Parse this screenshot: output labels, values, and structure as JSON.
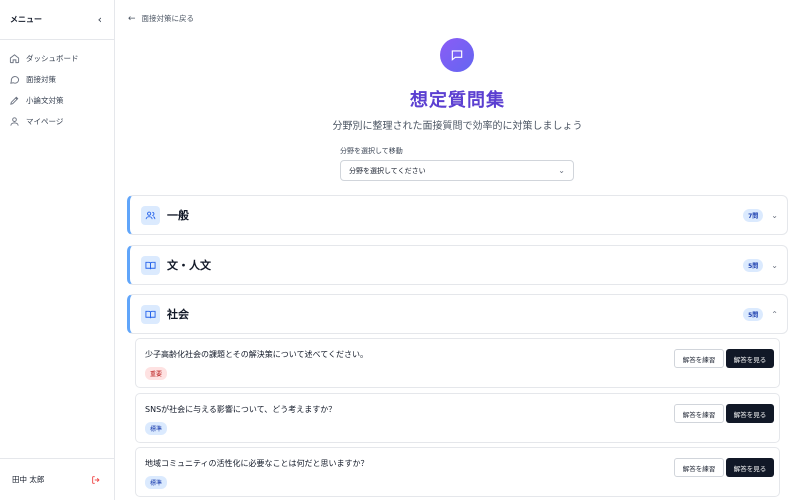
{
  "sidebar": {
    "title": "メニュー",
    "collapse_icon": "‹",
    "items": [
      {
        "label": "ダッシュボード",
        "icon": "home-icon"
      },
      {
        "label": "面接対策",
        "icon": "chat-bubble-icon"
      },
      {
        "label": "小論文対策",
        "icon": "pen-icon"
      },
      {
        "label": "マイページ",
        "icon": "user-icon"
      }
    ],
    "user_name": "田中 太郎",
    "logout_icon": "logout-icon"
  },
  "main": {
    "back_link": "面接対策に戻る",
    "title": "想定質問集",
    "subtitle": "分野別に整理された面接質問で効率的に対策しましょう",
    "select_label": "分野を選択して移動",
    "select_value": "分野を選択してください",
    "sections": [
      {
        "title": "一般",
        "count": "7問",
        "icon": "users-icon",
        "expanded": false
      },
      {
        "title": "文・人文",
        "count": "5問",
        "icon": "book-icon",
        "expanded": false
      },
      {
        "title": "社会",
        "count": "5問",
        "icon": "book-icon",
        "expanded": true
      }
    ],
    "questions": [
      {
        "text": "少子高齢化社会の課題とその解決策について述べてください。",
        "badge": "重要",
        "level": "important"
      },
      {
        "text": "SNSが社会に与える影響について、どう考えますか？",
        "badge": "標準",
        "level": "standard"
      },
      {
        "text": "地域コミュニティの活性化に必要なことは何だと思いますか？",
        "badge": "標準",
        "level": "standard"
      }
    ],
    "practice_label": "解答を練習",
    "view_label": "解答を見る"
  },
  "colors": {
    "accent": "#5b3fd1",
    "section_border": "#60a5fa",
    "important": "#b91c1c",
    "standard": "#1e40af"
  }
}
